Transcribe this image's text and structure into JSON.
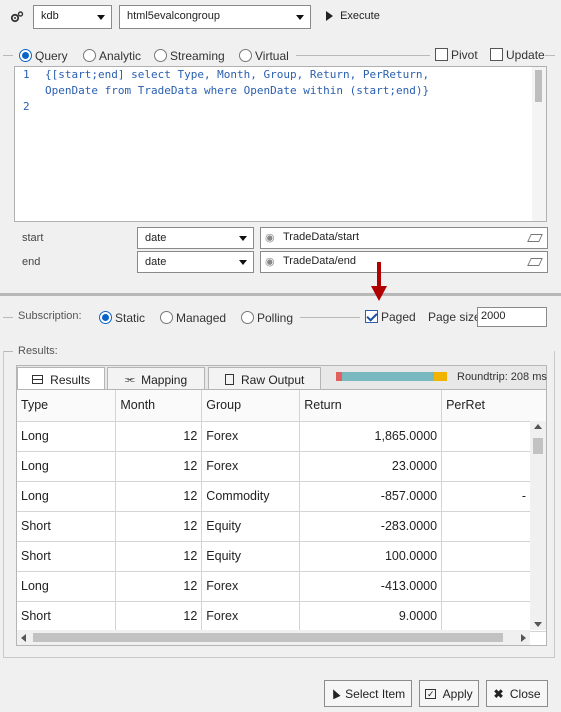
{
  "toolbar": {
    "server_icon": "gears-icon",
    "server": "kdb",
    "connection": "html5evalcongroup",
    "execute_label": "Execute"
  },
  "query_modes": {
    "options": [
      "Query",
      "Analytic",
      "Streaming",
      "Virtual"
    ],
    "selected": "Query",
    "pivot_label": "Pivot",
    "update_label": "Update"
  },
  "editor": {
    "line_numbers": [
      "1",
      "2"
    ],
    "lines": [
      "{[start;end] select Type, Month, Group, Return, PerReturn,",
      "OpenDate from TradeData where OpenDate within (start;end)}",
      ""
    ]
  },
  "params": [
    {
      "name": "start",
      "type": "date",
      "value": "TradeData/start"
    },
    {
      "name": "end",
      "type": "date",
      "value": "TradeData/end"
    }
  ],
  "subscription": {
    "label": "Subscription:",
    "options": [
      "Static",
      "Managed",
      "Polling"
    ],
    "selected": "Static",
    "paged_label": "Paged",
    "paged_checked": true,
    "page_size_label": "Page size:",
    "page_size": "2000"
  },
  "results": {
    "label": "Results:",
    "tabs": [
      "Results",
      "Mapping",
      "Raw Output"
    ],
    "roundtrip": "Roundtrip: 208 ms",
    "columns": [
      "Type",
      "Month",
      "Group",
      "Return",
      "PerRet"
    ],
    "rows": [
      [
        "Long",
        "12",
        "Forex",
        "1,865.0000",
        ""
      ],
      [
        "Long",
        "12",
        "Forex",
        "23.0000",
        ""
      ],
      [
        "Long",
        "12",
        "Commodity",
        "-857.0000",
        "-"
      ],
      [
        "Short",
        "12",
        "Equity",
        "-283.0000",
        ""
      ],
      [
        "Short",
        "12",
        "Equity",
        "100.0000",
        ""
      ],
      [
        "Long",
        "12",
        "Forex",
        "-413.0000",
        ""
      ],
      [
        "Short",
        "12",
        "Forex",
        "9.0000",
        ""
      ]
    ]
  },
  "buttons": {
    "select_item": "Select Item",
    "apply": "Apply",
    "close": "Close"
  },
  "colors": {
    "accent": "#0a64c8",
    "arrow": "#b00000",
    "roundtrip_teal": "#7ab8c0",
    "roundtrip_orange": "#f0b400",
    "roundtrip_red": "#e06060"
  }
}
